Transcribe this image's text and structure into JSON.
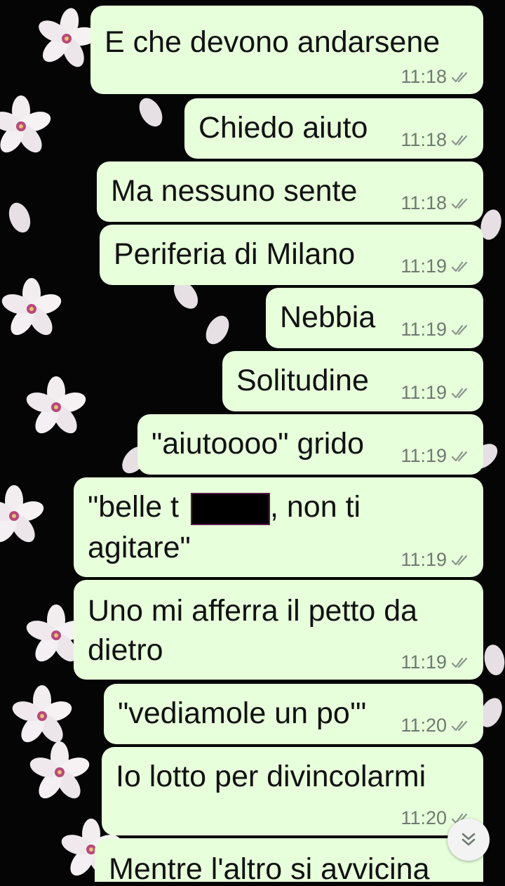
{
  "chat": {
    "messages": [
      {
        "lines": [
          "E che devono andarsene"
        ],
        "time": "11:18"
      },
      {
        "lines": [
          "Chiedo aiuto"
        ],
        "time": "11:18"
      },
      {
        "lines": [
          "Ma nessuno sente"
        ],
        "time": "11:18"
      },
      {
        "lines": [
          "Periferia di Milano"
        ],
        "time": "11:19"
      },
      {
        "lines": [
          "Nebbia"
        ],
        "time": "11:19"
      },
      {
        "lines": [
          "Solitudine"
        ],
        "time": "11:19"
      },
      {
        "lines": [
          "\"aiutoooo\" grido"
        ],
        "time": "11:19"
      },
      {
        "lines": [
          "\"belle t",
          ", non ti",
          "agitare\""
        ],
        "time": "11:19"
      },
      {
        "lines": [
          "Uno mi afferra il petto da",
          "dietro"
        ],
        "time": "11:19"
      },
      {
        "lines": [
          "\"vediamole un po'\""
        ],
        "time": "11:20"
      },
      {
        "lines": [
          "Io lotto per divincolarmi"
        ],
        "time": "11:20"
      },
      {
        "lines": [
          "Mentre l'altro si avvicina"
        ],
        "time": ""
      }
    ]
  },
  "icons": {
    "read_receipt": "double-check-icon",
    "scroll_down": "double-chevron-down-icon"
  },
  "colors": {
    "bubble": "#e7ffdb",
    "text": "#111111",
    "meta": "#6f7a70",
    "background": "#050505"
  }
}
